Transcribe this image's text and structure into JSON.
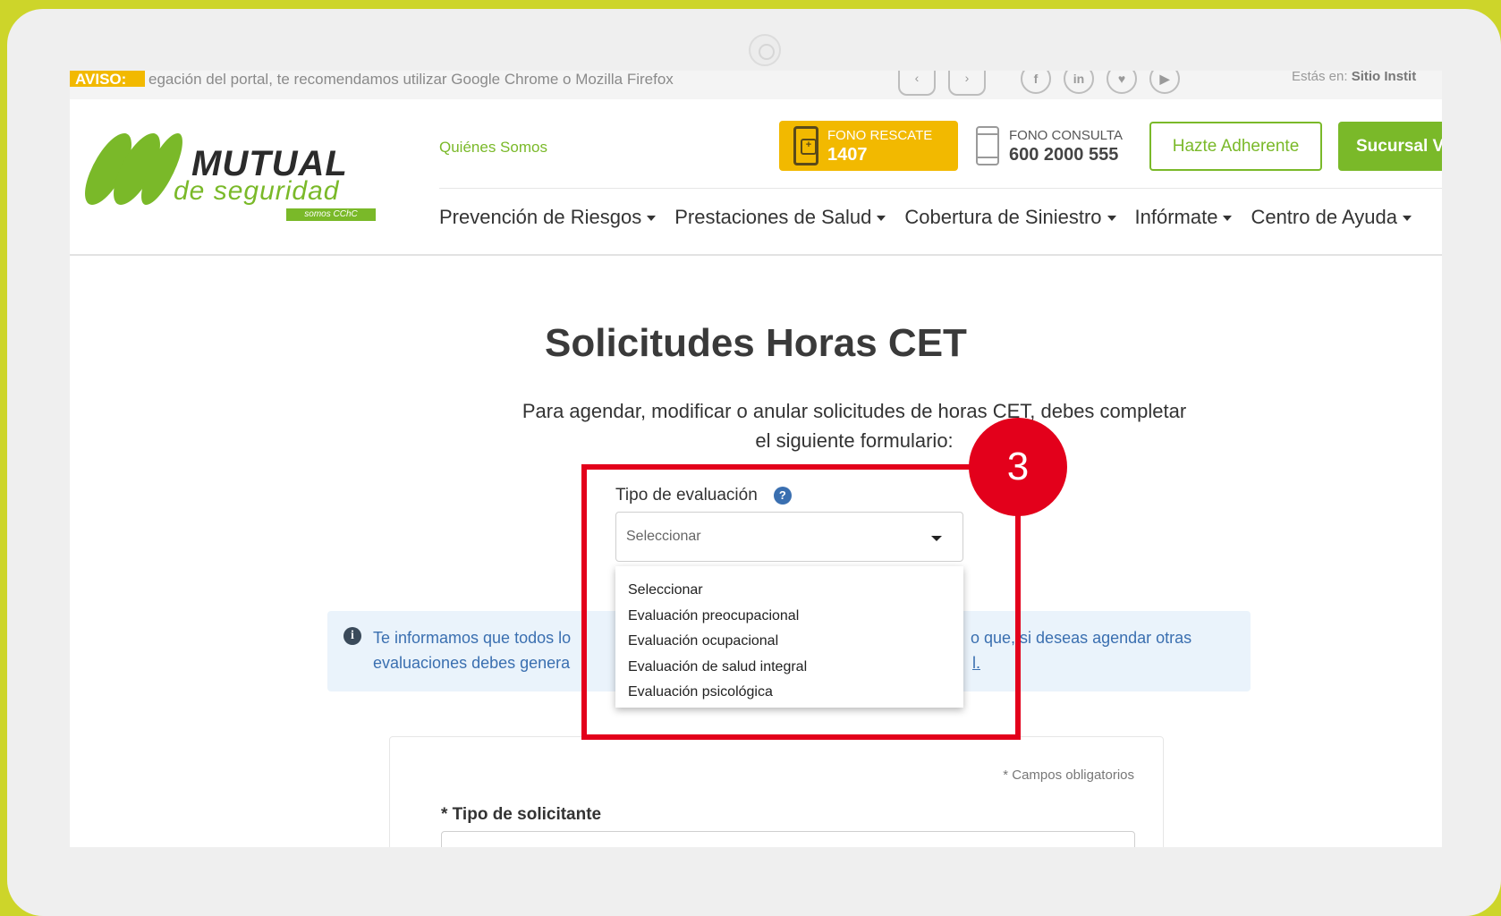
{
  "notice": {
    "badge": "AVISO:",
    "text": "egación del portal, te recomendamos utilizar Google Chrome o Mozilla Firefox",
    "breadcrumb_prefix": "Estás en:",
    "breadcrumb_site": "Sitio Instit"
  },
  "header": {
    "logo": {
      "word": "MUTUAL",
      "sub": "de seguridad",
      "tag": "somos CChC"
    },
    "quienes_somos": "Quiénes Somos",
    "fono_rescate": {
      "label": "FONO RESCATE",
      "number": "1407"
    },
    "fono_consulta": {
      "label": "FONO CONSULTA",
      "number": "600 2000 555"
    },
    "adherente_button": "Hazte Adherente",
    "sucursal_button": "Sucursal V",
    "nav": [
      "Prevención de Riesgos",
      "Prestaciones de Salud",
      "Cobertura de Siniestro",
      "Infórmate",
      "Centro de Ayuda"
    ]
  },
  "page": {
    "title": "Solicitudes Horas CET",
    "intro_line1": "Para agendar, modificar o anular solicitudes de horas CET, debes completar",
    "intro_line2": "el siguiente formulario:"
  },
  "evaluation": {
    "label": "Tipo de evaluación",
    "help_icon": "?",
    "selected": "Seleccionar",
    "options": [
      "Seleccionar",
      "Evaluación preocupacional",
      "Evaluación ocupacional",
      "Evaluación de salud integral",
      "Evaluación psicológica"
    ]
  },
  "info": {
    "icon": "i",
    "line1_start": "Te informamos que todos lo",
    "line1_end": "o que, si deseas agendar otras",
    "line2_start": "evaluaciones debes genera",
    "line2_end": "l."
  },
  "form": {
    "required_note": "* Campos obligatorios",
    "solicitante_label": "* Tipo de solicitante"
  },
  "annotation": {
    "step_number": "3",
    "color": "#e3001b"
  },
  "colors": {
    "brand_green": "#7ab929",
    "rescate_yellow": "#f2b900",
    "background": "#cdd52a"
  }
}
